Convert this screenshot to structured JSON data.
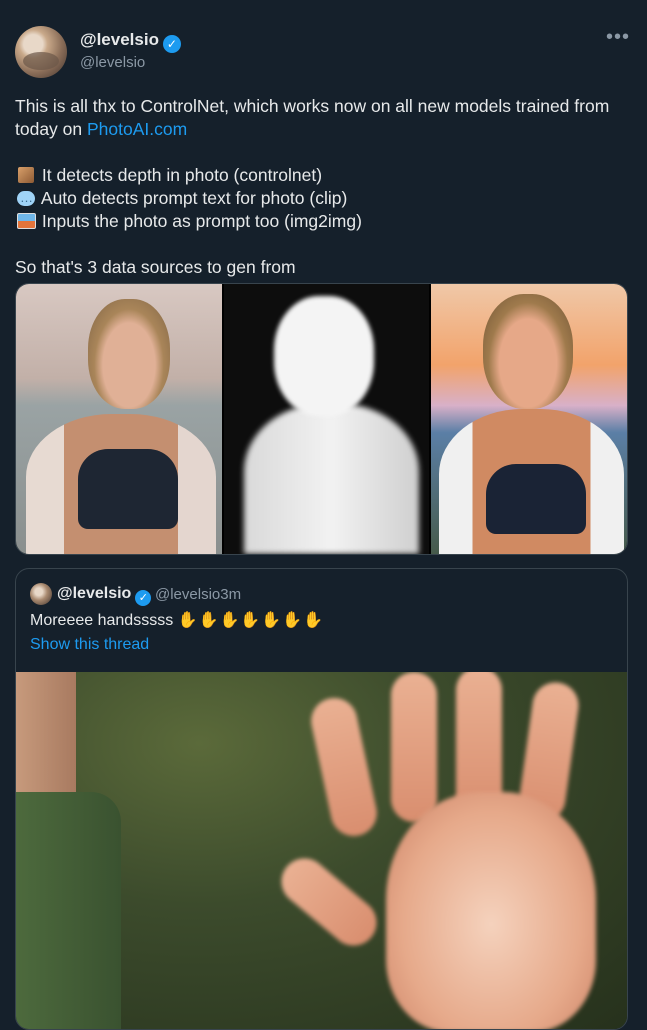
{
  "tweet": {
    "display_name": "@levelsio",
    "handle": "@levelsio",
    "verified_mark": "✓",
    "more_label": "•••",
    "line1": "This is all thx to ControlNet, which works now on all new models trained from today on ",
    "link": "PhotoAI.com",
    "bullet1": "It detects depth in photo (controlnet)",
    "bullet2": "Auto detects prompt text for photo (clip)",
    "bullet3": "Inputs the photo as prompt too (img2img)",
    "closing": "So that's 3 data sources to gen from",
    "icons": [
      "box-emoji-icon",
      "speech-bubble-emoji-icon",
      "framed-picture-emoji-icon"
    ]
  },
  "quote": {
    "display_name": "@levelsio",
    "handle_time": "@levelsio3m",
    "text": "Moreeee handsssss ",
    "hands": "✋✋✋✋✋✋✋",
    "show_thread": "Show this thread"
  },
  "colors": {
    "background": "#15202b",
    "text": "#e7e9ea",
    "muted": "#8b98a5",
    "link": "#1d9bf0",
    "border": "#38444d"
  }
}
